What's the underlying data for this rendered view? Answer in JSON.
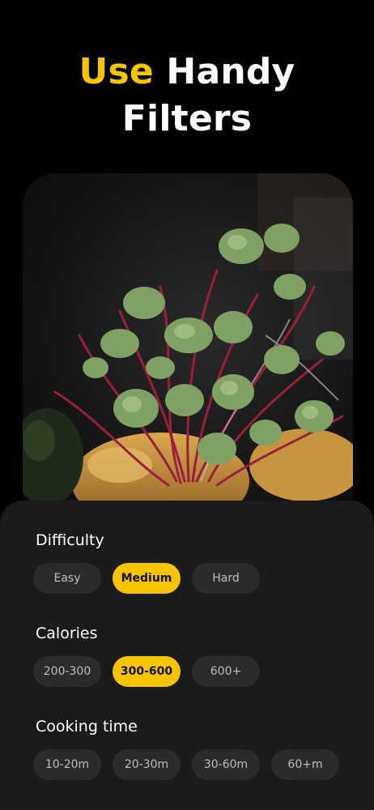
{
  "headline": {
    "accent": "Use",
    "line1_rest": " Handy",
    "line2": "Filters"
  },
  "colors": {
    "accent": "#f7c500",
    "background": "#000000",
    "panel": "#1b1b1b",
    "chip": "#2b2b2b"
  },
  "photo": {
    "subject": "microgreens-dish-photo"
  },
  "filters": {
    "difficulty": {
      "title": "Difficulty",
      "options": [
        {
          "label": "Easy",
          "selected": false
        },
        {
          "label": "Medium",
          "selected": true
        },
        {
          "label": "Hard",
          "selected": false
        }
      ]
    },
    "calories": {
      "title": "Calories",
      "options": [
        {
          "label": "200-300",
          "selected": false
        },
        {
          "label": "300-600",
          "selected": true
        },
        {
          "label": "600+",
          "selected": false
        }
      ]
    },
    "cooking_time": {
      "title": "Cooking time",
      "options": [
        {
          "label": "10-20m",
          "selected": false
        },
        {
          "label": "20-30m",
          "selected": false
        },
        {
          "label": "30-60m",
          "selected": false
        },
        {
          "label": "60+m",
          "selected": false
        }
      ]
    }
  }
}
